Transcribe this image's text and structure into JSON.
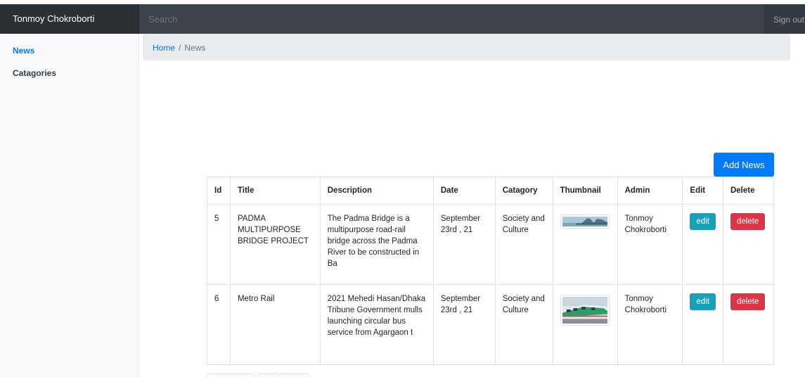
{
  "navbar": {
    "brand": "Tonmoy Chokroborti",
    "search_placeholder": "Search",
    "signout": "Sign out"
  },
  "sidebar": {
    "items": [
      {
        "label": "News"
      },
      {
        "label": "Catagories"
      }
    ]
  },
  "breadcrumb": {
    "home": "Home",
    "separator": "/",
    "current": "News"
  },
  "add_button": "Add News",
  "table": {
    "headers": [
      "Id",
      "Title",
      "Description",
      "Date",
      "Catagory",
      "Thumbnail",
      "Admin",
      "Edit",
      "Delete"
    ],
    "rows": [
      {
        "id": "5",
        "title": "PADMA MULTIPURPOSE BRIDGE PROJECT",
        "description": "The Padma Bridge is a multipurpose road-rail bridge across the Padma River to be constructed in Ba",
        "date": "September 23rd , 21",
        "category": "Society and Culture",
        "admin": "Tonmoy Chokroborti",
        "edit": "edit",
        "delete": "delete"
      },
      {
        "id": "6",
        "title": "Metro Rail",
        "description": "2021 Mehedi Hasan/Dhaka Tribune Government mulls launching circular bus service from Agargaon t",
        "date": "September 23rd , 21",
        "category": "Society and Culture",
        "admin": "Tonmoy Chokroborti",
        "edit": "edit",
        "delete": "delete"
      }
    ]
  },
  "colors": {
    "primary": "#007bff",
    "info": "#17a2b8",
    "danger": "#dc3545",
    "navbar": "#343a40"
  }
}
